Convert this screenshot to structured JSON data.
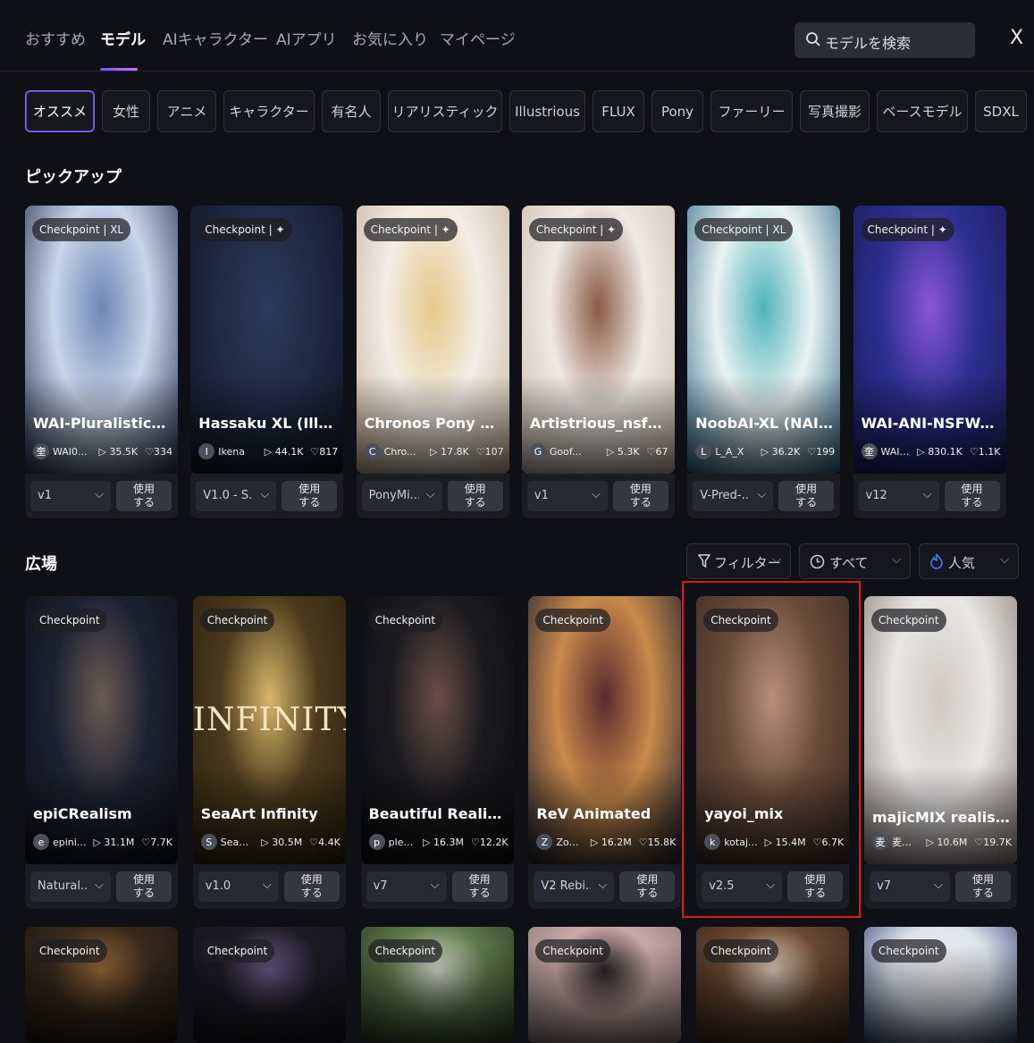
{
  "nav": {
    "tabs": [
      "おすすめ",
      "モデル",
      "AIキャラクター",
      "AIアプリ",
      "お気に入り",
      "マイページ"
    ],
    "active_tab": "モデル",
    "search_placeholder": "モデルを検索",
    "close": "X"
  },
  "categories": {
    "items": [
      "オススメ",
      "女性",
      "アニメ",
      "キャラクター",
      "有名人",
      "リアリスティック",
      "Illustrious",
      "FLUX",
      "Pony",
      "ファーリー",
      "写真撮影",
      "ベースモデル",
      "SDXL"
    ],
    "active": "オススメ"
  },
  "pickup": {
    "title": "ピックアップ",
    "cards": [
      {
        "badge": "Checkpoint | XL",
        "title": "WAI-Pluralistic-Noob",
        "avatar": "奎",
        "author": "WAI0...",
        "runs": "35.5K",
        "likes": "334",
        "version": "v1",
        "use": "使用する",
        "colors": [
          "#c8d6ea",
          "#6f86b6",
          "#2a3350"
        ]
      },
      {
        "badge": "Checkpoint | ✦",
        "title": "Hassaku XL (Illustri...",
        "avatar": "I",
        "author": "Ikena",
        "runs": "44.1K",
        "likes": "817",
        "version": "V1.0 - S...",
        "use": "使用する",
        "colors": [
          "#1f2a44",
          "#2d3a5e",
          "#101522"
        ]
      },
      {
        "badge": "Checkpoint | ✦",
        "title": "Chronos Pony Mix",
        "avatar": "C",
        "author": "Chro...",
        "runs": "17.8K",
        "likes": "107",
        "version": "PonyMi...",
        "use": "使用する",
        "colors": [
          "#f3ede6",
          "#e6c98a",
          "#c8b29a"
        ]
      },
      {
        "badge": "Checkpoint | ✦",
        "title": "Artistrious_nsfw-lill...",
        "avatar": "G",
        "author": "Goof...",
        "runs": "5.3K",
        "likes": "67",
        "version": "v1",
        "use": "使用する",
        "colors": [
          "#efe9e4",
          "#8a5a44",
          "#cdbcae"
        ]
      },
      {
        "badge": "Checkpoint | XL",
        "title": "NoobAI-XL (NAI-XL)",
        "avatar": "L",
        "author": "L_A_X",
        "runs": "36.2K",
        "likes": "199",
        "version": "V-Pred-...",
        "use": "使用する",
        "colors": [
          "#e9f3f1",
          "#4fb3bd",
          "#2f6a8a"
        ]
      },
      {
        "badge": "Checkpoint | ✦",
        "title": "WAI-ANI-NSFW--PO...",
        "avatar": "奎",
        "author": "WAI0...",
        "runs": "830.1K",
        "likes": "1.1K",
        "version": "v12",
        "use": "使用する",
        "colors": [
          "#2b2f8f",
          "#8a55d8",
          "#1a1c5a"
        ]
      }
    ]
  },
  "plaza": {
    "title": "広場",
    "filters": {
      "filter": "フィルター",
      "time": "すべて",
      "sort": "人気"
    },
    "cards": [
      {
        "badge": "Checkpoint",
        "title": "epiCRealism",
        "avatar": "e",
        "author": "epini...",
        "runs": "31.1M",
        "likes": "7.7K",
        "version": "Natural...",
        "use": "使用する",
        "colors": [
          "#1d2233",
          "#6b5a52",
          "#0d0f16"
        ]
      },
      {
        "badge": "Checkpoint",
        "title": "SeaArt Infinity",
        "avatar": "S",
        "author": "SeaA...",
        "runs": "30.5M",
        "likes": "4.4K",
        "version": "v1.0",
        "use": "使用する",
        "colors": [
          "#4b3a1c",
          "#d8b66a",
          "#2a2010"
        ],
        "overlay_text": "INFINITY"
      },
      {
        "badge": "Checkpoint",
        "title": "Beautiful Realistic A...",
        "avatar": "p",
        "author": "plea...",
        "runs": "16.3M",
        "likes": "12.2K",
        "version": "v7",
        "use": "使用する",
        "colors": [
          "#1a1a1f",
          "#6a4e46",
          "#0b0b0e"
        ]
      },
      {
        "badge": "Checkpoint",
        "title": "ReV Animated",
        "avatar": "Z",
        "author": "Zovya",
        "runs": "16.2M",
        "likes": "15.8K",
        "version": "V2 Rebi...",
        "use": "使用する",
        "colors": [
          "#c98a4a",
          "#5a2a2e",
          "#1c1e2c"
        ]
      },
      {
        "badge": "Checkpoint",
        "title": "yayoi_mix",
        "avatar": "k",
        "author": "kotaj...",
        "runs": "15.4M",
        "likes": "6.7K",
        "version": "v2.5",
        "use": "使用する",
        "colors": [
          "#6a4b3a",
          "#b8907a",
          "#3a2a22"
        ]
      },
      {
        "badge": "Checkpoint",
        "title": "majicMIX realistic 麦...",
        "avatar": "麦",
        "author": "麦橘...",
        "runs": "10.6M",
        "likes": "19.7K",
        "version": "v7",
        "use": "使用する",
        "colors": [
          "#e8e6e4",
          "#cfc9c4",
          "#8a7f78"
        ]
      }
    ],
    "more_cards": [
      {
        "badge": "Checkpoint",
        "colors": [
          "#3a2a1c",
          "#9a6a3a",
          "#1e1610"
        ]
      },
      {
        "badge": "Checkpoint",
        "colors": [
          "#1e1b26",
          "#6a5a86",
          "#141218"
        ]
      },
      {
        "badge": "Checkpoint",
        "colors": [
          "#5e7a4a",
          "#d8dccf",
          "#2e3a24"
        ]
      },
      {
        "badge": "Checkpoint",
        "colors": [
          "#c9a9a6",
          "#2a2224",
          "#8a7a7c"
        ]
      },
      {
        "badge": "Checkpoint",
        "colors": [
          "#6b4a33",
          "#e1cdbd",
          "#3a2618"
        ]
      },
      {
        "badge": "Checkpoint",
        "colors": [
          "#dde3ec",
          "#f2f2f4",
          "#3a4a7a"
        ]
      }
    ]
  }
}
